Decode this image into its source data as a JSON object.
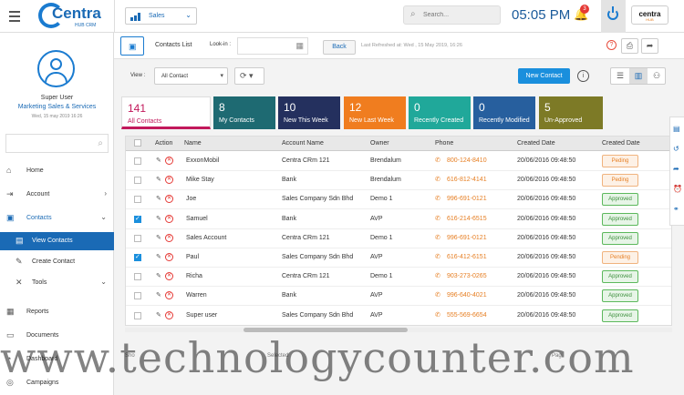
{
  "header": {
    "logo_text": "Centra",
    "logo_sub": "HUB CRM",
    "module": "Sales",
    "search_placeholder": "Search...",
    "time": "05:05 PM",
    "notifications": "3",
    "brand": "centra",
    "brand_sub": "HUB"
  },
  "user": {
    "name": "Super User",
    "dept": "Marketing Sales & Services",
    "date": "Wed, 15 may 2019 16:26"
  },
  "sidebar": {
    "items": [
      {
        "label": "Home",
        "icon": "home-icon"
      },
      {
        "label": "Account",
        "icon": "account-icon"
      },
      {
        "label": "Contacts",
        "icon": "contacts-icon"
      },
      {
        "label": "View Contacts",
        "icon": "view-contacts-icon"
      },
      {
        "label": "Create Contact",
        "icon": "create-contact-icon"
      },
      {
        "label": "Tools",
        "icon": "tools-icon"
      },
      {
        "label": "Reports",
        "icon": "reports-icon"
      },
      {
        "label": "Documents",
        "icon": "documents-icon"
      },
      {
        "label": "Dashboard",
        "icon": "dashboard-icon"
      },
      {
        "label": "Campaigns",
        "icon": "campaigns-icon"
      }
    ]
  },
  "page": {
    "title": "Contacts List",
    "look_in": "Look-in :",
    "back": "Back",
    "refreshed": "Last Refreshed at: Wed , 15 May 2019, 16:26",
    "view_label": "View :",
    "view_value": "All Contact",
    "new_contact": "New Contact"
  },
  "cards": [
    {
      "num": "141",
      "label": "All Contacts",
      "color": "#ffffff"
    },
    {
      "num": "8",
      "label": "My Contacts",
      "color": "#1e6a72"
    },
    {
      "num": "10",
      "label": "New This Week",
      "color": "#24305e"
    },
    {
      "num": "12",
      "label": "New Last Week",
      "color": "#f07d1f"
    },
    {
      "num": "0",
      "label": "Recently Created",
      "color": "#20a89a"
    },
    {
      "num": "0",
      "label": "Recently Modified",
      "color": "#275f9e"
    },
    {
      "num": "5",
      "label": "Un-Approved",
      "color": "#7d7a26"
    }
  ],
  "table": {
    "headers": [
      "Action",
      "Name",
      "Account Name",
      "Owner",
      "Phone",
      "Created Date",
      "Created Date"
    ],
    "rows": [
      {
        "name": "ExxonMobil",
        "account": "Centra CRm 121",
        "owner": "Brendalum",
        "phone": "800-124-8410",
        "date": "20/06/2016  09:48:50",
        "status": "Peding",
        "checked": false
      },
      {
        "name": "Mike Stay",
        "account": "Bank",
        "owner": "Brendalum",
        "phone": "616-812-4141",
        "date": "20/06/2016  09:48:50",
        "status": "Peding",
        "checked": false
      },
      {
        "name": "Joe",
        "account": "Sales Company Sdn Bhd",
        "owner": "Demo 1",
        "phone": "996-691-0121",
        "date": "20/06/2016  09:48:50",
        "status": "Approved",
        "checked": false
      },
      {
        "name": "Samuel",
        "account": "Bank",
        "owner": "AVP",
        "phone": "616-214-6515",
        "date": "20/06/2016  09:48:50",
        "status": "Approved",
        "checked": true
      },
      {
        "name": "Sales Account",
        "account": "Centra CRm 121",
        "owner": "Demo 1",
        "phone": "996-691-0121",
        "date": "20/06/2016  09:48:50",
        "status": "Approved",
        "checked": false
      },
      {
        "name": "Paul",
        "account": "Sales Company Sdn Bhd",
        "owner": "AVP",
        "phone": "616-412-6151",
        "date": "20/06/2016  09:48:50",
        "status": "Pending",
        "checked": true
      },
      {
        "name": "Richa",
        "account": "Centra CRm 121",
        "owner": "Demo 1",
        "phone": "903-273-0265",
        "date": "20/06/2016  09:48:50",
        "status": "Approved",
        "checked": false
      },
      {
        "name": "Warren",
        "account": "Bank",
        "owner": "AVP",
        "phone": "996-640-4021",
        "date": "20/06/2016  09:48:50",
        "status": "Approved",
        "checked": false
      },
      {
        "name": "Super user",
        "account": "Sales Company Sdn Bhd",
        "owner": "AVP",
        "phone": "555-569-6654",
        "date": "20/06/2016  09:48:50",
        "status": "Approved",
        "checked": false
      }
    ]
  },
  "pager": {
    "show": "Sho",
    "selected": "Selected",
    "page": "Pag"
  },
  "watermark": "www.technologycounter.com",
  "colors": {
    "accent": "#1a8fdd",
    "brand": "#1a6ab5",
    "pending": "#e67e22",
    "approved": "#3c8f3c"
  }
}
